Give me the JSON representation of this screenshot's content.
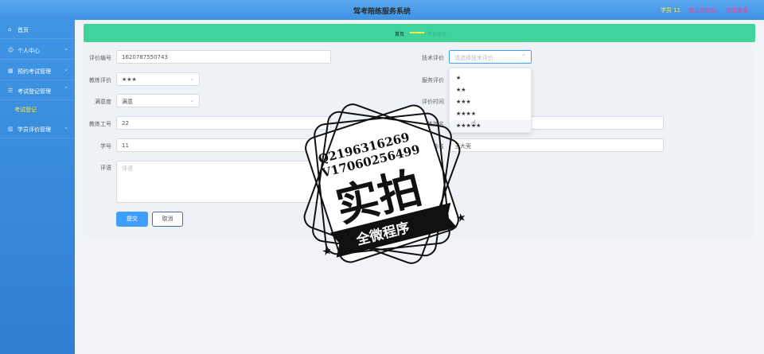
{
  "header": {
    "title": "驾考陪练服务系统",
    "user": "学员 11",
    "exit_to_front": "退出到前台",
    "logout": "退出登录"
  },
  "sidebar": {
    "items": [
      {
        "label": "首页",
        "icon": "home-icon"
      },
      {
        "label": "个人中心",
        "icon": "user-icon"
      },
      {
        "label": "预约考试管理",
        "icon": "table-icon"
      },
      {
        "label": "考试登记管理",
        "icon": "list-icon"
      },
      {
        "label": "学员评价管理",
        "icon": "chart-icon"
      }
    ],
    "sub_item": "考试登记"
  },
  "breadcrumb": {
    "home": "首页",
    "current": "学员评价"
  },
  "form": {
    "eval_no_label": "评价编号",
    "eval_no_value": "1620787550743",
    "coach_rating_label": "教练评价",
    "coach_rating_value": "★★★",
    "satisfaction_label": "满意度",
    "satisfaction_value": "满意",
    "coach_id_label": "教练工号",
    "coach_id_value": "22",
    "student_id_label": "学号",
    "student_id_value": "11",
    "comment_label": "评语",
    "comment_placeholder": "评语",
    "tech_rating_label": "技术评价",
    "tech_rating_placeholder": "请选择技术评价",
    "service_rating_label": "服务评价",
    "eval_time_label": "评价时间",
    "coach_name_label": "教练姓名",
    "student_name_label": "姓名",
    "student_name_value": "王大壳",
    "submit_label": "提交",
    "cancel_label": "取消"
  },
  "dropdown_options": [
    "★",
    "★★",
    "★★★",
    "★★★★",
    "★★★★★"
  ],
  "watermark": {
    "line1": "Q2196316269",
    "line2": "V17060256499",
    "main": "实拍",
    "ribbon": "全微程序"
  },
  "colors": {
    "header_blue": "#4a9fea",
    "sidebar_blue": "#3789dc",
    "banner_green": "#41d39c",
    "user_yellow": "#ffe74c",
    "link_pink": "#e6439a",
    "primary_button": "#409eff"
  }
}
